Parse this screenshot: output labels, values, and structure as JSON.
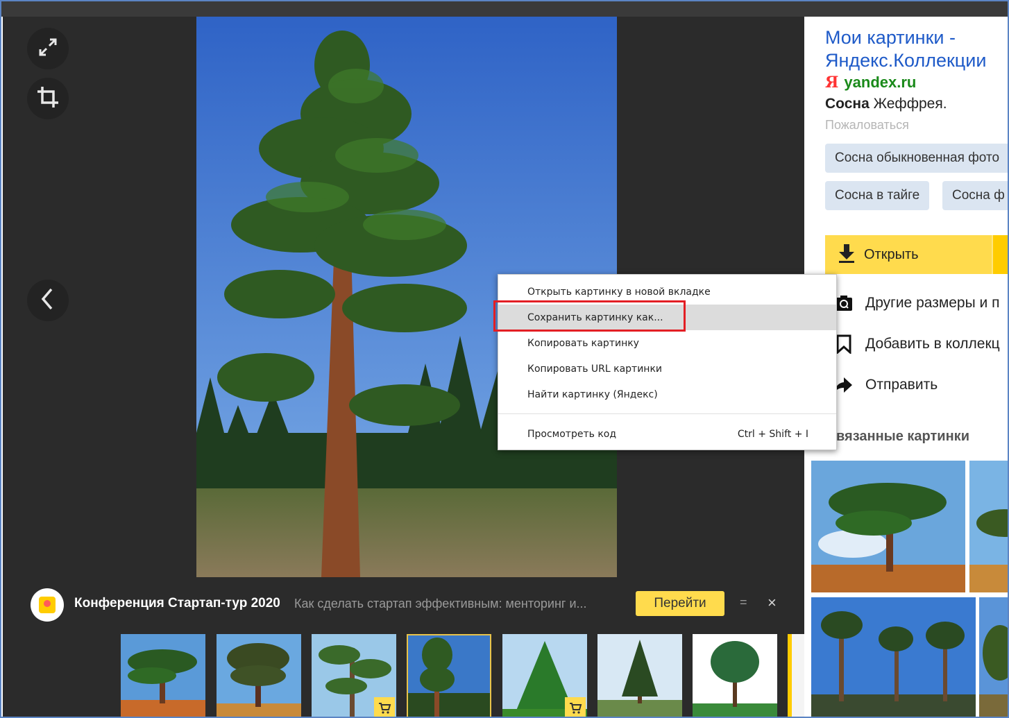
{
  "ad": {
    "title": "Конференция Стартап-тур 2020",
    "description": "Как сделать стартап эффективным: менторинг и...",
    "button": "Перейти",
    "menu": "=",
    "close": "×"
  },
  "panel": {
    "title": "Мои картинки - Яндекс.Коллекции",
    "domain_logo": "Я",
    "domain": "yandex.ru",
    "desc_bold": "Сосна",
    "desc_rest": " Жеффрея.",
    "complain": "Пожаловаться",
    "tags": [
      "Сосна обыкновенная фото",
      "Сосна в тайге",
      "Сосна ф"
    ],
    "open_button": "Открыть",
    "actions": [
      {
        "label": "Другие размеры и п",
        "icon": "search-camera-icon"
      },
      {
        "label": "Добавить в коллекц",
        "icon": "bookmark-icon"
      },
      {
        "label": "Отправить",
        "icon": "share-arrow-icon"
      }
    ],
    "related_title": "вязанные картинки"
  },
  "context_menu": {
    "items": [
      "Открыть картинку в новой вкладке",
      "Сохранить картинку как...",
      "Копировать картинку",
      "Копировать URL картинки",
      "Найти картинку (Яндекс)"
    ],
    "inspect": "Просмотреть код",
    "inspect_shortcut": "Ctrl + Shift + I",
    "highlighted_index": 1
  },
  "colors": {
    "viewer_bg": "#2b2b2b",
    "accent_yellow": "#ffdb4d",
    "link_blue": "#1e5ac8",
    "domain_green": "#1a8a1a",
    "highlight_red": "#e31e24"
  }
}
